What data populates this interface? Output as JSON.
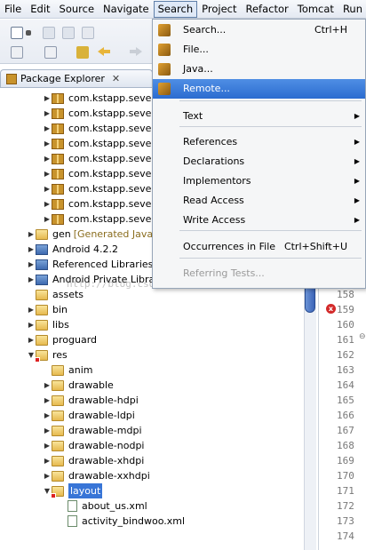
{
  "menubar": {
    "items": [
      "File",
      "Edit",
      "Source",
      "Navigate",
      "Search",
      "Project",
      "Refactor",
      "Tomcat",
      "Run"
    ]
  },
  "package_explorer": {
    "title": "Package Explorer",
    "close_glyph": "✕",
    "tree": [
      {
        "label": "com.kstapp.seve",
        "icon": "package-icon"
      },
      {
        "label": "com.kstapp.seve",
        "icon": "package-icon"
      },
      {
        "label": "com.kstapp.seve",
        "icon": "package-icon"
      },
      {
        "label": "com.kstapp.seve",
        "icon": "package-icon"
      },
      {
        "label": "com.kstapp.seve",
        "icon": "package-icon"
      },
      {
        "label": "com.kstapp.seve",
        "icon": "package-icon"
      },
      {
        "label": "com.kstapp.seve",
        "icon": "package-icon"
      },
      {
        "label": "com.kstapp.seve",
        "icon": "package-icon"
      },
      {
        "label": "com.kstapp.seve",
        "icon": "package-icon"
      },
      {
        "label": "gen",
        "suffix": "[Generated Java",
        "icon": "folder-icon"
      },
      {
        "label": "Android 4.2.2",
        "icon": "library-icon"
      },
      {
        "label": "Referenced Libraries",
        "icon": "library-icon"
      },
      {
        "label": "Android Private Libraries",
        "icon": "library-icon"
      },
      {
        "label": "assets",
        "icon": "folder-icon"
      },
      {
        "label": "bin",
        "icon": "folder-icon"
      },
      {
        "label": "libs",
        "icon": "folder-icon"
      },
      {
        "label": "proguard",
        "icon": "folder-icon"
      },
      {
        "label": "res",
        "icon": "folder-error-icon"
      },
      {
        "label": "anim",
        "icon": "folder-icon"
      },
      {
        "label": "drawable",
        "icon": "folder-icon"
      },
      {
        "label": "drawable-hdpi",
        "icon": "folder-icon"
      },
      {
        "label": "drawable-ldpi",
        "icon": "folder-icon"
      },
      {
        "label": "drawable-mdpi",
        "icon": "folder-icon"
      },
      {
        "label": "drawable-nodpi",
        "icon": "folder-icon"
      },
      {
        "label": "drawable-xhdpi",
        "icon": "folder-icon"
      },
      {
        "label": "drawable-xxhdpi",
        "icon": "folder-icon"
      },
      {
        "label": "layout",
        "icon": "folder-error-icon"
      },
      {
        "label": "about_us.xml",
        "icon": "xml-file-icon"
      },
      {
        "label": "activity_bindwoo.xml",
        "icon": "xml-file-icon"
      }
    ]
  },
  "search_menu": {
    "items": [
      {
        "label": "Search...",
        "accel": "Ctrl+H",
        "icon": "search-icon"
      },
      {
        "label": "File...",
        "accel": "",
        "icon": "file-search-icon"
      },
      {
        "label": "Java...",
        "accel": "",
        "icon": "java-search-icon"
      },
      {
        "label": "Remote...",
        "accel": "",
        "icon": "remote-search-icon"
      },
      {
        "label": "Text",
        "accel": "",
        "icon": ""
      },
      {
        "label": "References",
        "accel": "",
        "icon": ""
      },
      {
        "label": "Declarations",
        "accel": "",
        "icon": ""
      },
      {
        "label": "Implementors",
        "accel": "",
        "icon": ""
      },
      {
        "label": "Read Access",
        "accel": "",
        "icon": ""
      },
      {
        "label": "Write Access",
        "accel": "",
        "icon": ""
      },
      {
        "label": "Occurrences in File",
        "accel": "Ctrl+Shift+U",
        "icon": ""
      },
      {
        "label": "Referring Tests...",
        "accel": "",
        "icon": ""
      }
    ],
    "submenu_arrow": "▶"
  },
  "editor": {
    "line_numbers": [
      "158",
      "159",
      "160",
      "161",
      "162",
      "163",
      "164",
      "165",
      "166",
      "167",
      "168",
      "169",
      "170",
      "171",
      "172",
      "173",
      "174"
    ],
    "error_marker": "x",
    "fold_glyph": "⊖"
  },
  "watermark": "http://blog.csdn.net/knockheart",
  "colors": {
    "menu_highlight": "#2b6cd0",
    "selection": "#3875d7",
    "error": "#d32a2a"
  }
}
